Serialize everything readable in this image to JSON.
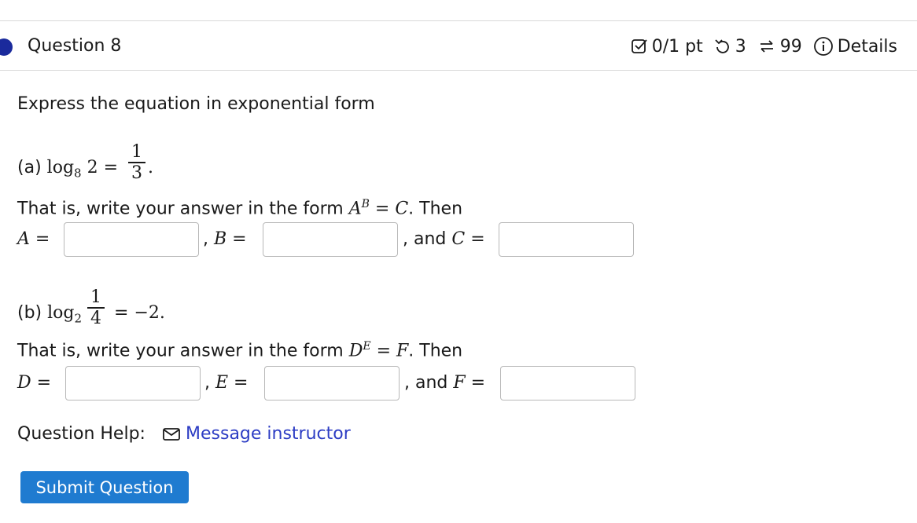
{
  "header": {
    "question_title": "Question 8",
    "score": "0/1 pt",
    "retries": "3",
    "attempts": "99",
    "details_label": "Details"
  },
  "question": {
    "instruction": "Express the equation in exponential form",
    "part_a": {
      "label": "(a)",
      "log_base": "8",
      "arg": "2",
      "rhs_num": "1",
      "rhs_den": "3",
      "form_text": "That is, write your answer in the form",
      "form_vars": [
        "A",
        "B",
        "C"
      ],
      "then_text": ". Then"
    },
    "part_b": {
      "label": "(b)",
      "log_base": "2",
      "arg_num": "1",
      "arg_den": "4",
      "rhs": "−2.",
      "form_text": "That is, write your answer in the form",
      "form_vars": [
        "D",
        "E",
        "F"
      ],
      "then_text": ". Then"
    },
    "and_text": ", and",
    "comma_text": ","
  },
  "help": {
    "label": "Question Help:",
    "message_label": "Message instructor"
  },
  "submit_label": "Submit Question",
  "colors": {
    "accent": "#1f7bd0",
    "link": "#2d3dc4",
    "dot": "#1a2a9c"
  }
}
